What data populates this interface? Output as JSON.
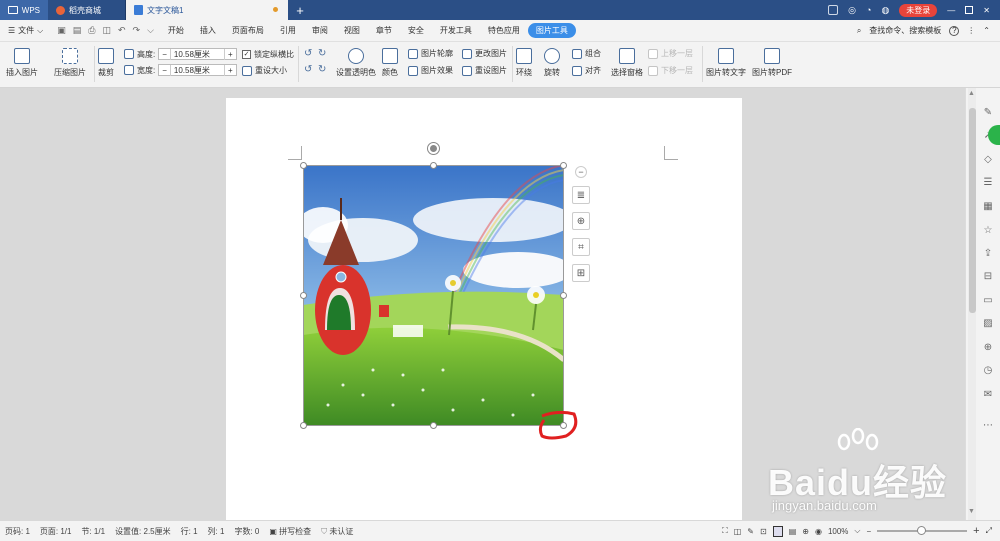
{
  "titlebar": {
    "tabs": [
      {
        "label": "WPS"
      },
      {
        "label": "稻壳商城"
      },
      {
        "label": "文字文稿1"
      }
    ],
    "login_label": "未登录"
  },
  "menubar": {
    "file_label": "文件",
    "items": [
      "开始",
      "插入",
      "页面布局",
      "引用",
      "审阅",
      "视图",
      "章节",
      "安全",
      "开发工具",
      "特色应用",
      "图片工具"
    ],
    "search_label": "查找命令、搜索模板"
  },
  "ribbon": {
    "insert_picture": "插入图片",
    "compress_picture": "压缩图片",
    "crop": "裁剪",
    "height_label": "高度:",
    "height_value": "10.58厘米",
    "width_label": "宽度:",
    "width_value": "10.58厘米",
    "lock_ratio": "锁定纵横比",
    "reset_size": "重设大小",
    "set_transparent": "设置透明色",
    "color": "颜色",
    "picture_outline": "图片轮廓",
    "picture_effect": "图片效果",
    "change_picture": "更改图片",
    "reset_picture": "重设图片",
    "wrap": "环绕",
    "rotate": "旋转",
    "group": "组合",
    "align": "对齐",
    "selection_pane": "选择窗格",
    "bring_forward": "上移一层",
    "send_backward": "下移一层",
    "pic_to_text": "图片转文字",
    "pic_to_pdf": "图片转PDF"
  },
  "statusbar": {
    "page_no": "页码: 1",
    "pages": "页面: 1/1",
    "section": "节: 1/1",
    "setting": "设置值: 2.5厘米",
    "row": "行: 1",
    "col": "列: 1",
    "words": "字数: 0",
    "spellcheck": "拼写检查",
    "certified": "未认证",
    "zoom": "100%"
  },
  "watermark": {
    "brand": "Baidu经验",
    "url": "jingyan.baidu.com"
  },
  "colors": {
    "titlebar": "#2b4f86",
    "accent": "#3b8ee8",
    "login": "#e8443a",
    "annotation": "#e02020"
  }
}
